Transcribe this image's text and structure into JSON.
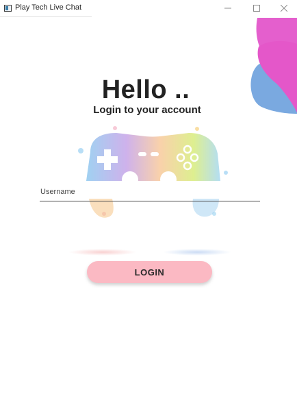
{
  "window": {
    "title": "Play Tech Live Chat",
    "controls": {
      "minimize_icon": "minimize-icon",
      "maximize_icon": "maximize-icon",
      "close_icon": "close-icon"
    }
  },
  "login": {
    "greeting": "Hello ..",
    "subtitle": "Login to your account",
    "username_placeholder": "Username",
    "username_value": "",
    "button_label": "LOGIN"
  },
  "colors": {
    "button_bg": "#fbb9c3",
    "deco_magenta": "#e457c9",
    "deco_blue": "#7aa9e0",
    "text_dark": "#222222"
  },
  "icons": {
    "app": "app-window-icon",
    "controller": "gamepad-watercolor-icon"
  }
}
